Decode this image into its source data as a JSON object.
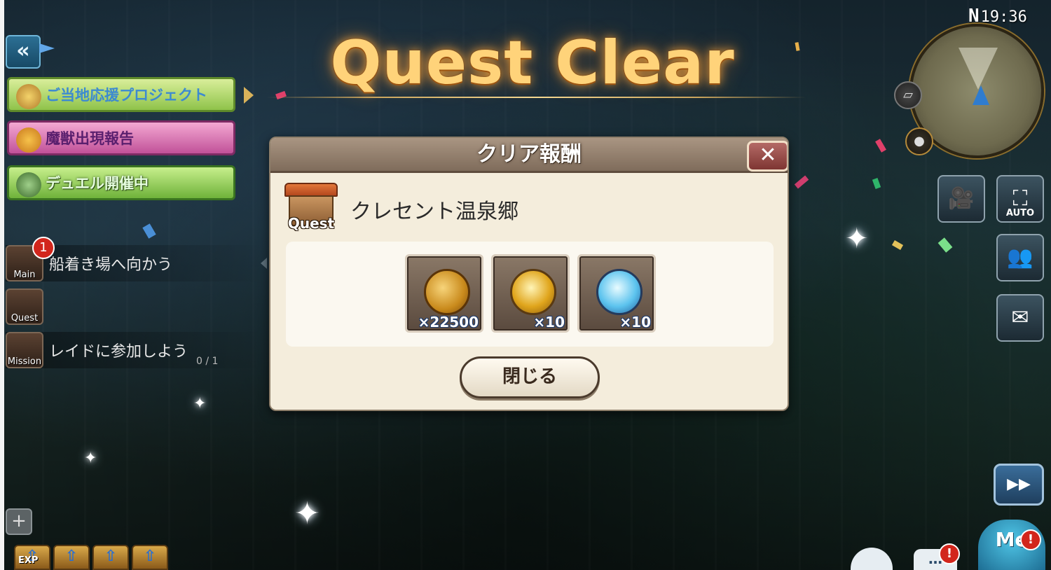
{
  "status": {
    "compass": "N",
    "time": "19:36"
  },
  "title": {
    "text": "Quest Clear"
  },
  "left_panel": {
    "back_icon": "double-chevron-left-icon",
    "banners": [
      {
        "label": "ご当地応援プロジェクト",
        "icon": "mascot-icon"
      },
      {
        "label": "魔獣出現報告",
        "icon": "beast-mask-icon"
      },
      {
        "label": "デュエル開催中",
        "icon": "crossed-swords-icon"
      }
    ],
    "tasks": [
      {
        "icon_label": "Main",
        "text": "船着き場へ向かう",
        "badge": "1",
        "progress": ""
      },
      {
        "icon_label": "Quest",
        "text": "",
        "badge": "",
        "progress": ""
      },
      {
        "icon_label": "Mission",
        "text": "レイドに参加しよう",
        "badge": "",
        "progress": "0 / 1"
      }
    ]
  },
  "dialog": {
    "header": "クリア報酬",
    "close_icon": "close-x-icon",
    "quest_icon_label": "Quest",
    "quest_name": "クレセント温泉郷",
    "rewards": [
      {
        "item": "gold-coin-icon",
        "qty": "×22500"
      },
      {
        "item": "gold-orb-icon",
        "qty": "×10"
      },
      {
        "item": "blue-orb-icon",
        "qty": "×10"
      }
    ],
    "close_button": "閉じる"
  },
  "right_panel": {
    "camera_icon": "movie-camera-icon",
    "auto_label": "AUTO",
    "party_icon": "party-icon",
    "mail_icon": "mail-group-icon"
  },
  "bottom": {
    "exp_label": "EXP",
    "menu_label": "Me",
    "chat_alert": "!",
    "menu_alert": "!"
  },
  "colors": {
    "title_gold": "#ffd37a",
    "dialog_bg": "#f4eddc",
    "header_bg": "#8f7c6a",
    "alert_red": "#d2261c"
  }
}
